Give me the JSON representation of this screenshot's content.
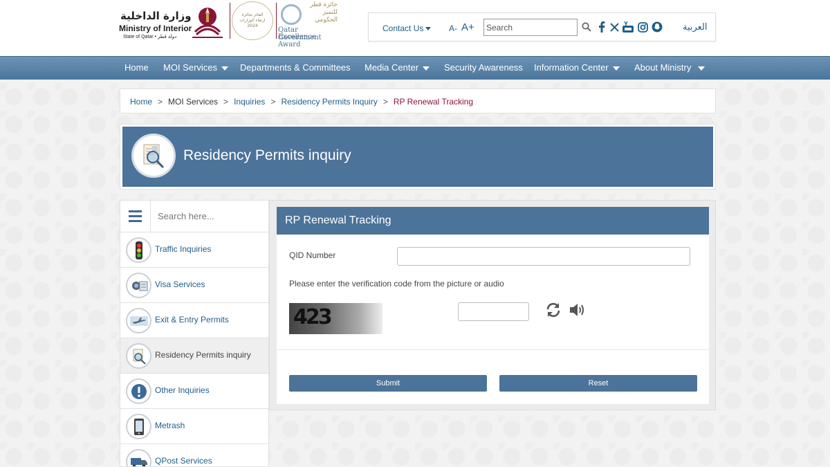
{
  "header": {
    "logo_arabic": "وزارة الداخلية",
    "logo_english": "Ministry of Interior",
    "logo_sub": "State of Qatar • دولة قطر",
    "award_badge_lines": [
      "الفائز بجائزة",
      "ارتقاء الوزارات",
      "2024"
    ],
    "award_arabic_lines": [
      "جائزة قطر",
      "للتميز",
      "الحكومي"
    ],
    "award_english_line1": "Qatar Government",
    "award_english_line2": "Excellence Award",
    "contact_us": "Contact Us",
    "font_decrease": "A-",
    "font_increase": "A+",
    "search_placeholder": "Search",
    "language_toggle": "العربية",
    "social_icons": [
      "facebook-icon",
      "x-icon",
      "youtube-icon",
      "instagram-icon",
      "snapchat-icon"
    ]
  },
  "nav": {
    "items": [
      {
        "label": "Home",
        "dropdown": false
      },
      {
        "label": "MOI Services",
        "dropdown": true
      },
      {
        "label": "Departments & Committees",
        "dropdown": false
      },
      {
        "label": "Media Center",
        "dropdown": true
      },
      {
        "label": "Security Awareness",
        "dropdown": false
      },
      {
        "label": "Information Center",
        "dropdown": true
      },
      {
        "label": "About Ministry",
        "dropdown": true
      }
    ]
  },
  "breadcrumb": {
    "items": [
      "Home",
      "MOI Services",
      "Inquiries",
      "Residency Permits Inquiry",
      "RP Renewal Tracking"
    ],
    "separator": ">"
  },
  "banner": {
    "title": "Residency Permits inquiry"
  },
  "sidebar": {
    "search_placeholder": "Search here...",
    "items": [
      {
        "label": "Traffic Inquiries",
        "icon": "traffic-light-icon",
        "active": false
      },
      {
        "label": "Visa Services",
        "icon": "visa-icon",
        "active": false
      },
      {
        "label": "Exit & Entry Permits",
        "icon": "airplane-icon",
        "active": false
      },
      {
        "label": "Residency Permits inquiry",
        "icon": "document-magnifier-icon",
        "active": true
      },
      {
        "label": "Other Inquiries",
        "icon": "exclamation-icon",
        "active": false
      },
      {
        "label": "Metrash",
        "icon": "mobile-app-icon",
        "active": false
      },
      {
        "label": "QPost Services",
        "icon": "delivery-truck-icon",
        "active": false
      }
    ]
  },
  "form": {
    "title": "RP Renewal Tracking",
    "qid_label": "QID Number",
    "qid_value": "",
    "verification_prompt": "Please enter the verification code from the picture or audio",
    "captcha_text": "423",
    "code_value": "",
    "submit_label": "Submit",
    "reset_label": "Reset"
  },
  "colors": {
    "primary_blue": "#4c7399",
    "link_blue": "#1d5e8a",
    "maroon": "#8a1538"
  }
}
